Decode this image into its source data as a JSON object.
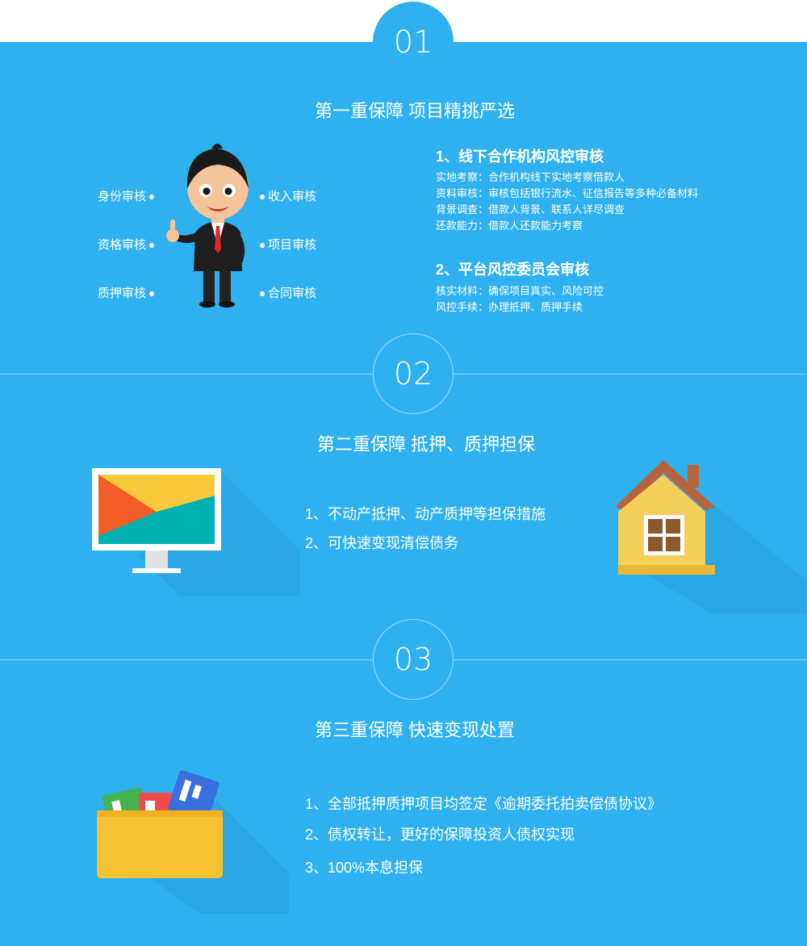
{
  "sections": [
    {
      "badge": "01",
      "title": "第一重保障  项目精挑严选",
      "left_items": [
        "身份审核",
        "资格审核",
        "质押审核"
      ],
      "right_items": [
        "收入审核",
        "项目审核",
        "合同审核"
      ],
      "blocks": [
        {
          "heading": "1、线下合作机构风控审核",
          "lines": [
            "实地考察：合作机构线下实地考察借款人",
            "资料审核：审核包括银行流水、征信报告等多种必备材料",
            "背景调查：借款人背景、联系人详尽调查",
            "还款能力：借款人还款能力考察"
          ]
        },
        {
          "heading": "2、平台风控委员会审核",
          "lines": [
            "核实材料：确保项目真实、风险可控",
            "风控手续：办理抵押、质押手续"
          ]
        }
      ]
    },
    {
      "badge": "02",
      "title": "第二重保障  抵押、质押担保",
      "bullets": [
        "1、不动产抵押、动产质押等担保措施",
        "2、可快速变现清偿债务"
      ]
    },
    {
      "badge": "03",
      "title": "第三重保障  快速变现处置",
      "bullets": [
        "1、全部抵押质押项目均签定《逾期委托拍卖偿债协议》",
        "2、债权转让，更好的保障投资人债权实现",
        "3、100%本息担保"
      ]
    }
  ],
  "colors": {
    "background": "#2fb1ef",
    "text": "#ffffff",
    "divider": "#8fd4f7"
  },
  "icons": [
    "businessman-thumbs-up-illustration",
    "monitor-icon",
    "house-icon",
    "folder-cards-icon"
  ]
}
